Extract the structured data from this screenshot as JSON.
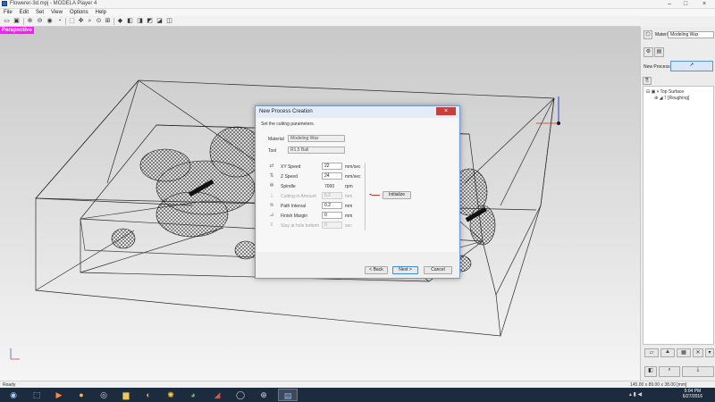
{
  "window": {
    "title": "Flowerer-3d.mpj - MODELA Player 4",
    "minimize_glyph": "–",
    "maximize_glyph": "□",
    "close_glyph": "×"
  },
  "menu": [
    "File",
    "Edit",
    "Set",
    "View",
    "Options",
    "Help"
  ],
  "view_label": "Perspective",
  "right_panel": {
    "material_label": "Material",
    "material_value": "Modeling Wax",
    "new_process_label": "New Process",
    "tree": {
      "top_surface": "Top Surface",
      "roughing": "[Roughing]"
    }
  },
  "dialog": {
    "title": "New Process Creation",
    "close_glyph": "×",
    "instruction": "Set the cutting parameters.",
    "material_label": "Material",
    "material_value": "Modeling Wax",
    "tool_label": "Tool",
    "tool_value": "R1.5 Ball",
    "params": [
      {
        "label": "XY Speed",
        "value": "22",
        "unit": "mm/sec",
        "enabled": true
      },
      {
        "label": "Z Speed",
        "value": "24",
        "unit": "mm/sec",
        "enabled": true
      },
      {
        "label": "Spindle",
        "value": "7000",
        "unit": "rpm",
        "enabled": true
      },
      {
        "label": "Cutting-in Amount",
        "value": "0.2",
        "unit": "mm",
        "enabled": false
      },
      {
        "label": "Path Interval",
        "value": "0.2",
        "unit": "mm",
        "enabled": true
      },
      {
        "label": "Finish Margin",
        "value": "0",
        "unit": "mm",
        "enabled": true
      },
      {
        "label": "Stay at hole bottom",
        "value": "0",
        "unit": "sec",
        "enabled": false
      }
    ],
    "initialize_label": "Initialize",
    "back_label": "< Back",
    "next_label": "Next >",
    "cancel_label": "Cancel"
  },
  "status": {
    "left": "Ready",
    "right": "145.00 x 89.00 x 38.00 [mm]"
  },
  "taskbar": {
    "time": "5:04 PM",
    "date": "6/27/2016"
  }
}
